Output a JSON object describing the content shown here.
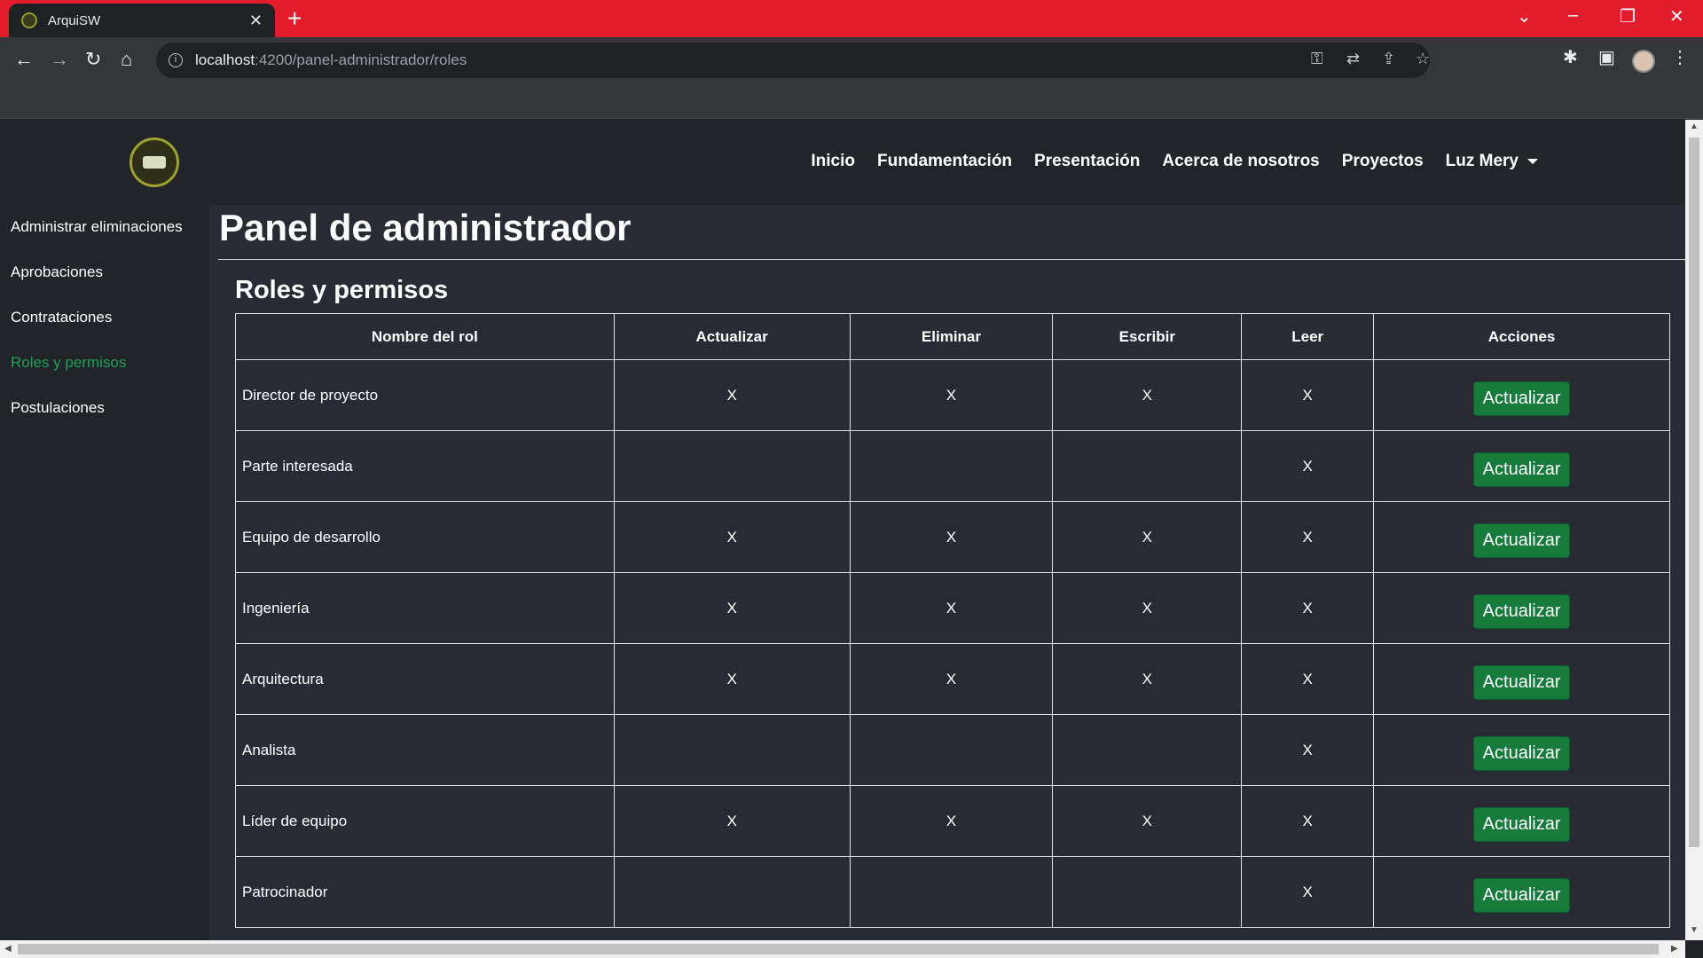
{
  "browser": {
    "tab_title": "ArquiSW",
    "url_host": "localhost",
    "url_path": ":4200/panel-administrador/roles"
  },
  "nav": {
    "links": [
      "Inicio",
      "Fundamentación",
      "Presentación",
      "Acerca de nosotros",
      "Proyectos"
    ],
    "user": "Luz Mery"
  },
  "sidebar": {
    "items": [
      {
        "label": "Administrar eliminaciones",
        "active": false
      },
      {
        "label": "Aprobaciones",
        "active": false
      },
      {
        "label": "Contrataciones",
        "active": false
      },
      {
        "label": "Roles y permisos",
        "active": true
      },
      {
        "label": "Postulaciones",
        "active": false
      }
    ]
  },
  "main": {
    "title": "Panel de administrador",
    "section_title": "Roles y permisos",
    "table": {
      "headers": [
        "Nombre del rol",
        "Actualizar",
        "Eliminar",
        "Escribir",
        "Leer",
        "Acciones"
      ],
      "action_label": "Actualizar",
      "rows": [
        {
          "role": "Director de proyecto",
          "actualizar": "X",
          "eliminar": "X",
          "escribir": "X",
          "leer": "X"
        },
        {
          "role": "Parte interesada",
          "actualizar": "",
          "eliminar": "",
          "escribir": "",
          "leer": "X"
        },
        {
          "role": "Equipo de desarrollo",
          "actualizar": "X",
          "eliminar": "X",
          "escribir": "X",
          "leer": "X"
        },
        {
          "role": "Ingeniería",
          "actualizar": "X",
          "eliminar": "X",
          "escribir": "X",
          "leer": "X"
        },
        {
          "role": "Arquitectura",
          "actualizar": "X",
          "eliminar": "X",
          "escribir": "X",
          "leer": "X"
        },
        {
          "role": "Analista",
          "actualizar": "",
          "eliminar": "",
          "escribir": "",
          "leer": "X"
        },
        {
          "role": "Líder de equipo",
          "actualizar": "X",
          "eliminar": "X",
          "escribir": "X",
          "leer": "X"
        },
        {
          "role": "Patrocinador",
          "actualizar": "",
          "eliminar": "",
          "escribir": "",
          "leer": "X"
        }
      ]
    }
  },
  "colors": {
    "browser_frame": "#e11d2b",
    "active_sidebar": "#1f9d55",
    "button_green": "#157a3c"
  }
}
